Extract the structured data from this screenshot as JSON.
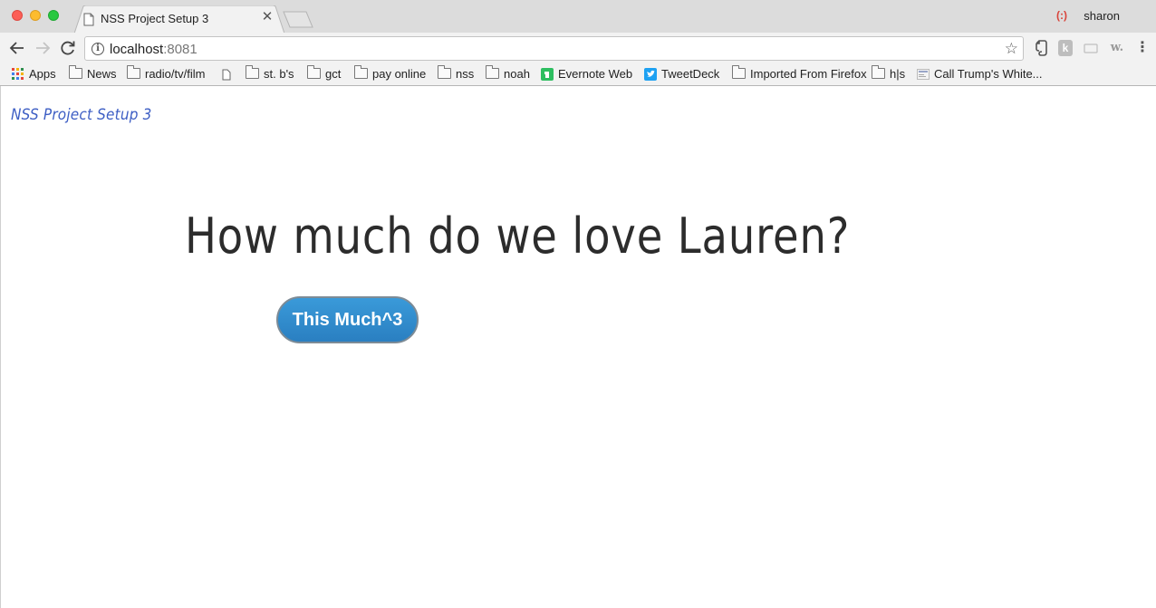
{
  "window": {
    "tab_title": "NSS Project Setup 3",
    "profile_name": "sharon",
    "profile_icon": "(:)"
  },
  "toolbar": {
    "url_host": "localhost",
    "url_port": ":8081"
  },
  "bookmarks": [
    {
      "label": "Apps",
      "icon": "apps-grid-icon"
    },
    {
      "label": "News",
      "icon": "folder-icon"
    },
    {
      "label": "radio/tv/film",
      "icon": "folder-icon"
    },
    {
      "label": "",
      "icon": "page-icon"
    },
    {
      "label": "st. b's",
      "icon": "folder-icon"
    },
    {
      "label": "gct",
      "icon": "folder-icon"
    },
    {
      "label": "pay online",
      "icon": "folder-icon"
    },
    {
      "label": "nss",
      "icon": "folder-icon"
    },
    {
      "label": "noah",
      "icon": "folder-icon"
    },
    {
      "label": "Evernote Web",
      "icon": "evernote-icon"
    },
    {
      "label": "TweetDeck",
      "icon": "twitter-icon"
    },
    {
      "label": "Imported From Firefox",
      "icon": "folder-icon"
    },
    {
      "label": "h|s",
      "icon": "folder-icon"
    },
    {
      "label": "Call Trump's White...",
      "icon": "site-thumbnail-icon"
    }
  ],
  "page": {
    "brand": "NSS Project Setup 3",
    "headline": "How much do we love Lauren?",
    "button_label": "This Much^3"
  },
  "colors": {
    "brand": "#3d5ec4",
    "button": "#2a8ad0",
    "headline": "#2c2c2c"
  }
}
